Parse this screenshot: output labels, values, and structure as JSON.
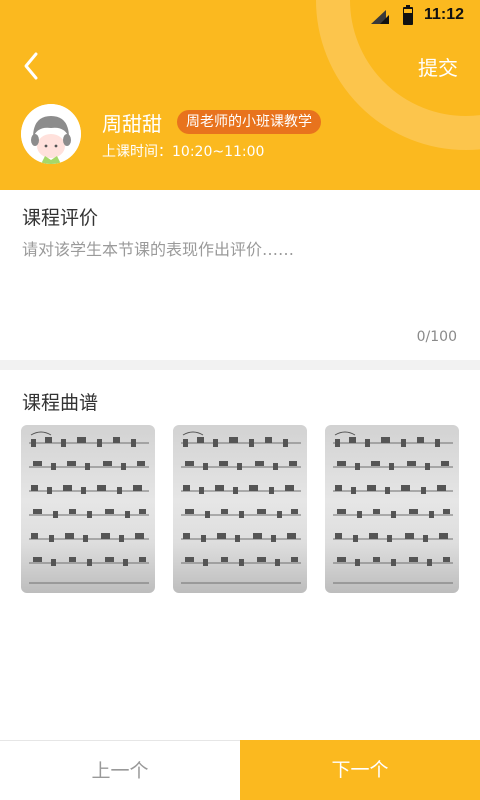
{
  "status_bar": {
    "time": "11:12",
    "icons": [
      "signal-icon",
      "battery-icon"
    ]
  },
  "header": {
    "back_icon": "chevron-left-icon",
    "submit_label": "提交",
    "student_name": "周甜甜",
    "class_badge": "周老师的小班课教学",
    "class_time": "上课时间：10:20~11:00",
    "colors": {
      "header_bg": "#fbb91f",
      "badge_bg": "#e8731d"
    }
  },
  "evaluation": {
    "title": "课程评价",
    "placeholder": "请对该学生本节课的表现作出评价……",
    "value": "",
    "char_count": "0/100"
  },
  "sheet_music": {
    "title": "课程曲谱",
    "items": [
      {
        "image": "sheet-music-thumbnail-1"
      },
      {
        "image": "sheet-music-thumbnail-2"
      },
      {
        "image": "sheet-music-thumbnail-3"
      }
    ]
  },
  "footer": {
    "prev_label": "上一个",
    "next_label": "下一个",
    "colors": {
      "next_bg": "#fbb91f",
      "prev_text": "#999999"
    }
  }
}
